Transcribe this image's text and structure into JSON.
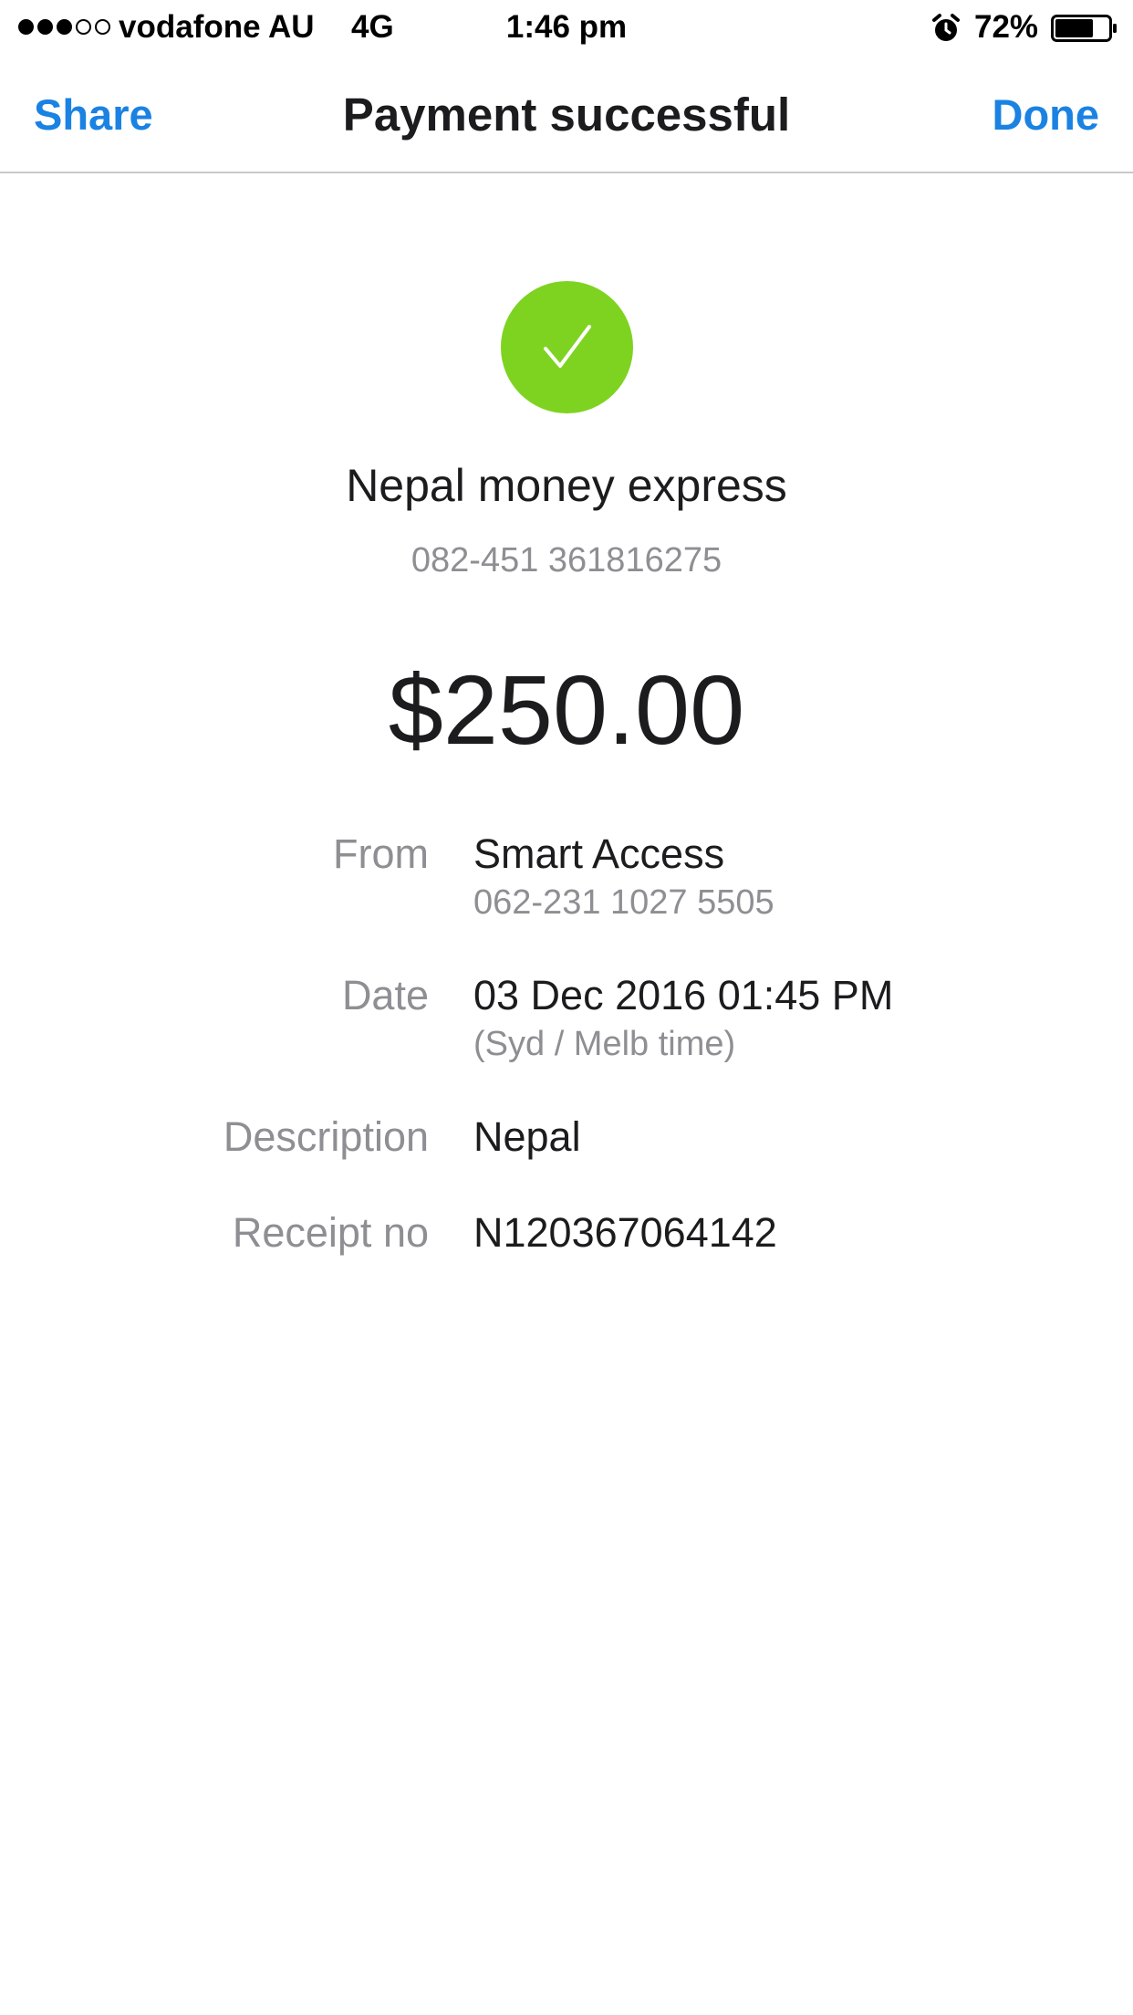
{
  "status_bar": {
    "signal_bars_filled": 3,
    "signal_bars_total": 5,
    "carrier": "vodafone AU",
    "network": "4G",
    "time": "1:46 pm",
    "alarm_icon": "alarm-clock-icon",
    "battery_percent": "72%",
    "battery_level": 0.72
  },
  "nav": {
    "share_label": "Share",
    "title": "Payment successful",
    "done_label": "Done"
  },
  "payment": {
    "status_icon": "checkmark-circle-icon",
    "payee_name": "Nepal money express",
    "payee_account": "082-451 361816275",
    "amount": "$250.00"
  },
  "details": {
    "from_label": "From",
    "from_value": "Smart Access",
    "from_sub": "062-231 1027 5505",
    "date_label": "Date",
    "date_value": "03 Dec 2016 01:45 PM",
    "date_sub": "(Syd / Melb time)",
    "description_label": "Description",
    "description_value": "Nepal",
    "receipt_label": "Receipt no",
    "receipt_value": "N120367064142"
  },
  "colors": {
    "accent": "#1a82e2",
    "success": "#7ed321",
    "secondary_text": "#8e8e93",
    "primary_text": "#1c1c1e",
    "divider": "#c8c8cc"
  }
}
